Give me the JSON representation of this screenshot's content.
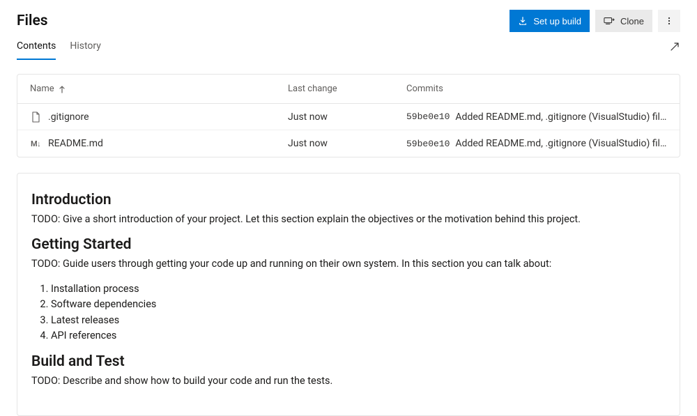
{
  "header": {
    "title": "Files",
    "setup_build": "Set up build",
    "clone": "Clone"
  },
  "tabs": {
    "contents": "Contents",
    "history": "History"
  },
  "columns": {
    "name": "Name",
    "last_change": "Last change",
    "commits": "Commits"
  },
  "files": [
    {
      "icon": "file",
      "name": ".gitignore",
      "last_change": "Just now",
      "commit_hash": "59be0e10",
      "commit_msg": "Added README.md, .gitignore (VisualStudio) file…"
    },
    {
      "icon": "md",
      "name": "README.md",
      "last_change": "Just now",
      "commit_hash": "59be0e10",
      "commit_msg": "Added README.md, .gitignore (VisualStudio) file…"
    }
  ],
  "readme": {
    "h_intro": "Introduction",
    "p_intro": "TODO: Give a short introduction of your project. Let this section explain the objectives or the motivation behind this project.",
    "h_getting_started": "Getting Started",
    "p_getting_started": "TODO: Guide users through getting your code up and running on their own system. In this section you can talk about:",
    "steps": [
      "Installation process",
      "Software dependencies",
      "Latest releases",
      "API references"
    ],
    "h_build": "Build and Test",
    "p_build": "TODO: Describe and show how to build your code and run the tests."
  }
}
